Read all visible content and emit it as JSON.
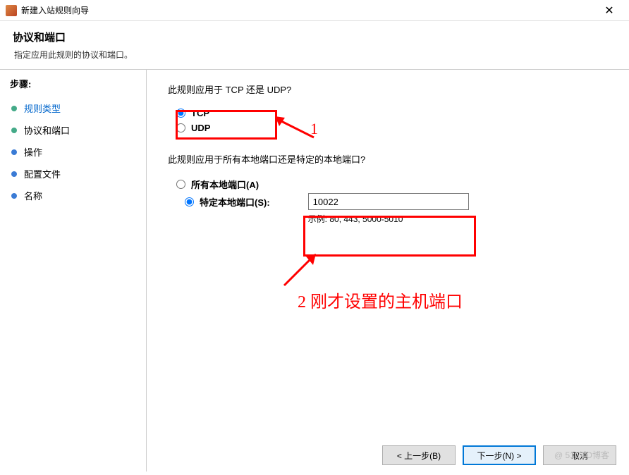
{
  "titlebar": {
    "title": "新建入站规则向导"
  },
  "header": {
    "title": "协议和端口",
    "subtitle": "指定应用此规则的协议和端口。"
  },
  "sidebar": {
    "heading": "步骤:",
    "items": [
      {
        "label": "规则类型"
      },
      {
        "label": "协议和端口"
      },
      {
        "label": "操作"
      },
      {
        "label": "配置文件"
      },
      {
        "label": "名称"
      }
    ]
  },
  "main": {
    "q1": "此规则应用于 TCP 还是 UDP?",
    "tcp": "TCP",
    "udp": "UDP",
    "q2": "此规则应用于所有本地端口还是特定的本地端口?",
    "allPorts": "所有本地端口(A)",
    "specificPorts": "特定本地端口(S):",
    "portValue": "10022",
    "portExample": "示例: 80, 443, 5000-5010"
  },
  "footer": {
    "back": "< 上一步(B)",
    "next": "下一步(N) >",
    "cancel": "取消"
  },
  "annotations": {
    "label1": "1",
    "label2": "2 刚才设置的主机端口"
  },
  "watermark": "@ 51CTO博客"
}
